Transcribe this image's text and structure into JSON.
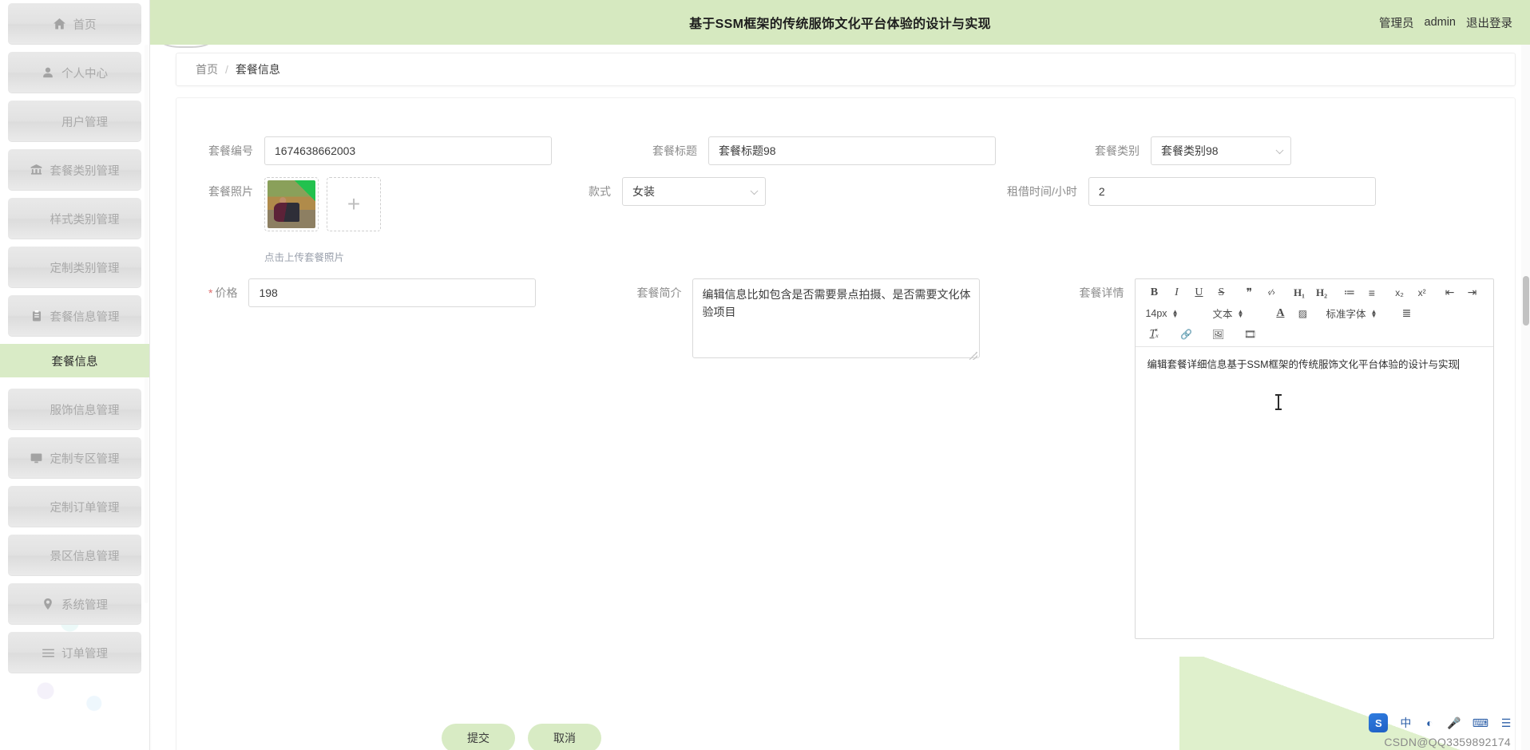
{
  "header": {
    "title": "基于SSM框架的传统服饰文化平台体验的设计与实现",
    "user_role": "管理员",
    "user_name": "admin",
    "logout_label": "退出登录",
    "bg_color": "#d6e9c0"
  },
  "sidebar": {
    "items": [
      {
        "label": "首页",
        "icon": "home-icon",
        "active": false
      },
      {
        "label": "个人中心",
        "icon": "user-icon",
        "active": false
      },
      {
        "label": "用户管理",
        "icon": "grid-icon",
        "active": false
      },
      {
        "label": "套餐类别管理",
        "icon": "bank-icon",
        "active": false
      },
      {
        "label": "样式类别管理",
        "icon": "grid-icon",
        "active": false
      },
      {
        "label": "定制类别管理",
        "icon": "grid-icon",
        "active": false
      },
      {
        "label": "套餐信息管理",
        "icon": "clipboard-icon",
        "active": false
      },
      {
        "label": "服饰信息管理",
        "icon": "grid-icon",
        "active": false
      },
      {
        "label": "定制专区管理",
        "icon": "monitor-icon",
        "active": false
      },
      {
        "label": "定制订单管理",
        "icon": "grid-icon",
        "active": false
      },
      {
        "label": "景区信息管理",
        "icon": "grid-icon",
        "active": false
      },
      {
        "label": "系统管理",
        "icon": "pin-icon",
        "active": false
      },
      {
        "label": "订单管理",
        "icon": "list-icon",
        "active": false
      }
    ],
    "sub_item": {
      "label": "套餐信息",
      "active": true,
      "active_bg": "#d9ebc6",
      "parent_index": 6
    }
  },
  "breadcrumb": {
    "home": "首页",
    "separator": "/",
    "current": "套餐信息"
  },
  "form": {
    "package_no": {
      "label": "套餐编号",
      "value": "1674638662003"
    },
    "package_title": {
      "label": "套餐标题",
      "value": "套餐标题98"
    },
    "package_category": {
      "label": "套餐类别",
      "value": "套餐类别98"
    },
    "package_photo": {
      "label": "套餐照片",
      "add_glyph": "+",
      "hint": "点击上传套餐照片"
    },
    "style": {
      "label": "款式",
      "value": "女装"
    },
    "rent_hours": {
      "label": "租借时间/小时",
      "value": "2"
    },
    "price": {
      "label": "价格",
      "value": "198",
      "required": true,
      "required_mark": "*"
    },
    "package_intro": {
      "label": "套餐简介",
      "value": "编辑信息比如包含是否需要景点拍摄、是否需要文化体验项目"
    },
    "package_detail": {
      "label": "套餐详情",
      "content": "编辑套餐详细信息基于SSM框架的传统服饰文化平台体验的设计与实现"
    }
  },
  "editor_toolbar": {
    "row1": [
      {
        "name": "bold-icon",
        "glyph": "B",
        "cls": "b"
      },
      {
        "name": "italic-icon",
        "glyph": "I",
        "cls": "i"
      },
      {
        "name": "underline-icon",
        "glyph": "U",
        "cls": "u"
      },
      {
        "name": "strikethrough-icon",
        "glyph": "S",
        "cls": "s"
      },
      {
        "name": "blockquote-icon",
        "glyph": "❞",
        "cls": ""
      },
      {
        "name": "code-icon",
        "glyph": "‹∕›",
        "cls": ""
      },
      {
        "name": "heading1-icon",
        "glyph": "H₁",
        "cls": "h"
      },
      {
        "name": "heading2-icon",
        "glyph": "H₂",
        "cls": "h"
      },
      {
        "name": "ordered-list-icon",
        "glyph": "≔",
        "cls": ""
      },
      {
        "name": "unordered-list-icon",
        "glyph": "≡",
        "cls": ""
      },
      {
        "name": "subscript-icon",
        "glyph": "x₂",
        "cls": ""
      },
      {
        "name": "superscript-icon",
        "glyph": "x²",
        "cls": ""
      },
      {
        "name": "outdent-icon",
        "glyph": "⇤",
        "cls": ""
      },
      {
        "name": "indent-icon",
        "glyph": "⇥",
        "cls": ""
      }
    ],
    "row2": {
      "font_size": "14px",
      "text_style": "文本",
      "font_color_glyph": "A",
      "highlight_glyph": "▨",
      "font_family": "标准字体",
      "align_glyph": "≣"
    },
    "row3": [
      {
        "name": "clear-format-icon",
        "glyph": "T̽ₓ"
      },
      {
        "name": "link-icon",
        "glyph": "🔗"
      },
      {
        "name": "image-icon",
        "glyph": "🖼"
      },
      {
        "name": "video-icon",
        "glyph": "🎞"
      }
    ]
  },
  "actions": {
    "submit": "提交",
    "cancel": "取消"
  },
  "ime": {
    "logo": "S",
    "lang": "中",
    "half_full": "◐",
    "mic": "🎤",
    "keyboard": "⌨",
    "menu": "☰"
  },
  "watermark": "CSDN@QQ3359892174"
}
